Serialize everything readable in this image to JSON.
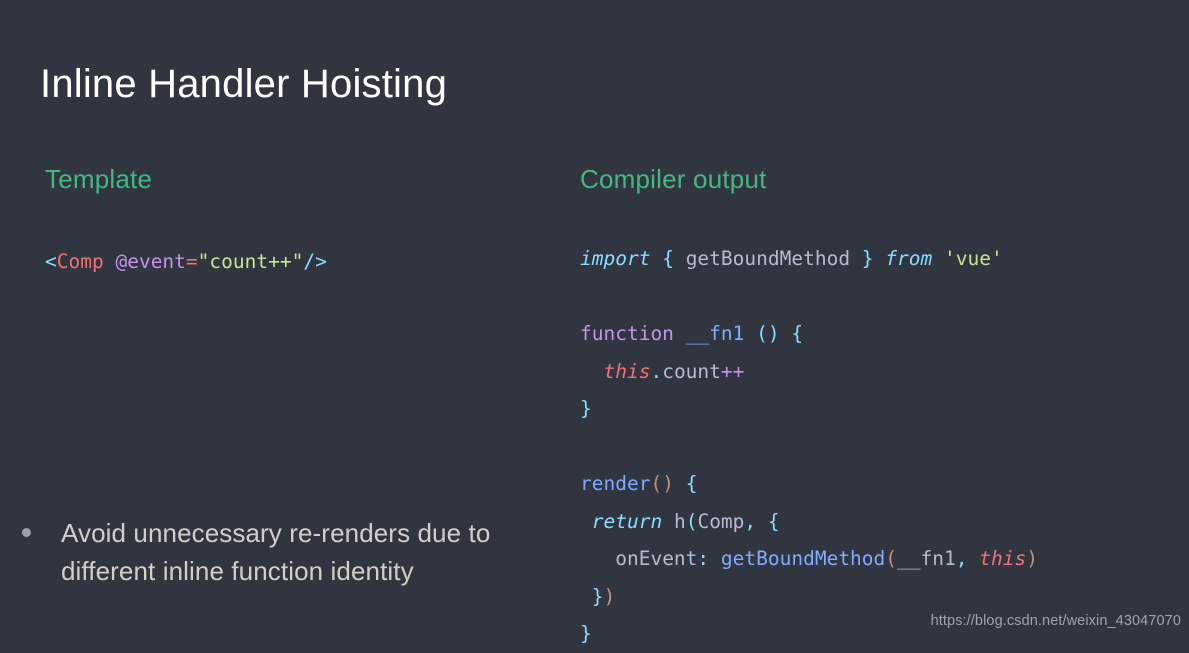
{
  "slide": {
    "title": "Inline Handler Hoisting",
    "background_color": "#31353f",
    "title_color": "#ffffff",
    "accent_color": "#42b983"
  },
  "left": {
    "heading": "Template",
    "code_tokens": [
      {
        "text": "<",
        "kind": "punct"
      },
      {
        "text": "Comp",
        "kind": "tag"
      },
      {
        "text": " ",
        "kind": "plain"
      },
      {
        "text": "@event",
        "kind": "attr"
      },
      {
        "text": "=",
        "kind": "eq"
      },
      {
        "text": "\"count++\"",
        "kind": "string"
      },
      {
        "text": "/>",
        "kind": "punct"
      }
    ],
    "code_plain": "<Comp @event=\"count++\"/>"
  },
  "right": {
    "heading": "Compiler output",
    "code_plain": "import { getBoundMethod } from 'vue'\n\nfunction __fn1 () {\n  this.count++\n}\n\nrender() {\n return h(Comp, {\n   onEvent: getBoundMethod(__fn1, this)\n })\n}",
    "lines": [
      "import { getBoundMethod } from 'vue'",
      "",
      "function __fn1 () {",
      "  this.count++",
      "}",
      "",
      "render() {",
      " return h(Comp, {",
      "   onEvent: getBoundMethod(__fn1, this)",
      " })",
      "}"
    ],
    "tokens": {
      "import": "import",
      "brace_open": "{",
      "get_bound_method": "getBoundMethod",
      "brace_close": "}",
      "from": "from",
      "module": "'vue'",
      "function": "function",
      "fn_name": "__fn1",
      "parens": "()",
      "this": "this",
      "dot": ".",
      "count": "count",
      "increment": "++",
      "render": "render",
      "return": "return",
      "h": "h",
      "comp": "Comp",
      "comma": ",",
      "on_event": "onEvent",
      "colon": ":",
      "close_brace_paren": "})"
    }
  },
  "bullets": [
    {
      "text": "Avoid unnecessary re-renders due to different inline function identity",
      "marker": "bullet-dot"
    }
  ],
  "watermark": {
    "text": "https://blog.csdn.net/weixin_43047070"
  }
}
